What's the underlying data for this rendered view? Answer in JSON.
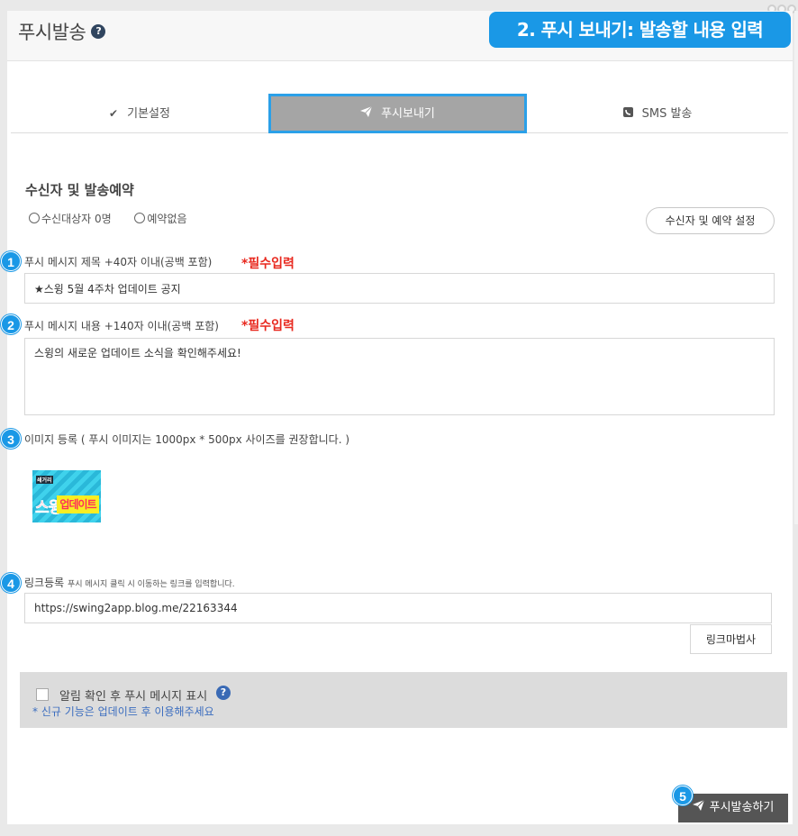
{
  "header": {
    "title": "푸시발송",
    "help_icon": "?",
    "banner": "2. 푸시 보내기: 발송할 내용 입력"
  },
  "tabs": [
    {
      "label": "기본설정",
      "icon": "check-icon"
    },
    {
      "label": "푸시보내기",
      "icon": "paper-plane-icon",
      "active": true
    },
    {
      "label": "SMS 발송",
      "icon": "phone-icon"
    }
  ],
  "section": {
    "title": "수신자 및 발송예약",
    "recipients": "수신대상자 0명",
    "reservation": "예약없음",
    "settings_button": "수신자 및 예약 설정"
  },
  "badges": [
    "1",
    "2",
    "3",
    "4",
    "5"
  ],
  "push_title": {
    "label": "푸시 메시지 제목 +40자 이내(공백 포함)",
    "required": "*필수입력",
    "value": "★스윙 5월 4주차 업데이트 공지"
  },
  "push_body": {
    "label": "푸시 메시지 내용 +140자 이내(공백 포함)",
    "required": "*필수입력",
    "value": "스윙의 새로운 업데이트 소식을 확인해주세요!"
  },
  "image": {
    "label": "이미지 등록 ( 푸시 이미지는 1000px * 500px 사이즈를 권장합니다. )",
    "thumb_small": "쇄거리",
    "thumb_a": "스윙",
    "thumb_b": "업데이트"
  },
  "link": {
    "label": "링크등록",
    "hint": "푸시 메시지 클릭 시 이동하는 링크를 입력합니다.",
    "value": "https://swing2app.blog.me/22163344",
    "wizard_button": "링크마법사"
  },
  "notify": {
    "checkbox_label": "알림 확인 후 푸시 메시지 표시",
    "help": "?",
    "note": "* 신규 기능은 업데이트 후 이용해주세요"
  },
  "send_button": "푸시발송하기",
  "colors": {
    "accent": "#1a98e6",
    "required": "#e8281e",
    "active_tab": "#a5a5a5",
    "send_button": "#555555"
  }
}
